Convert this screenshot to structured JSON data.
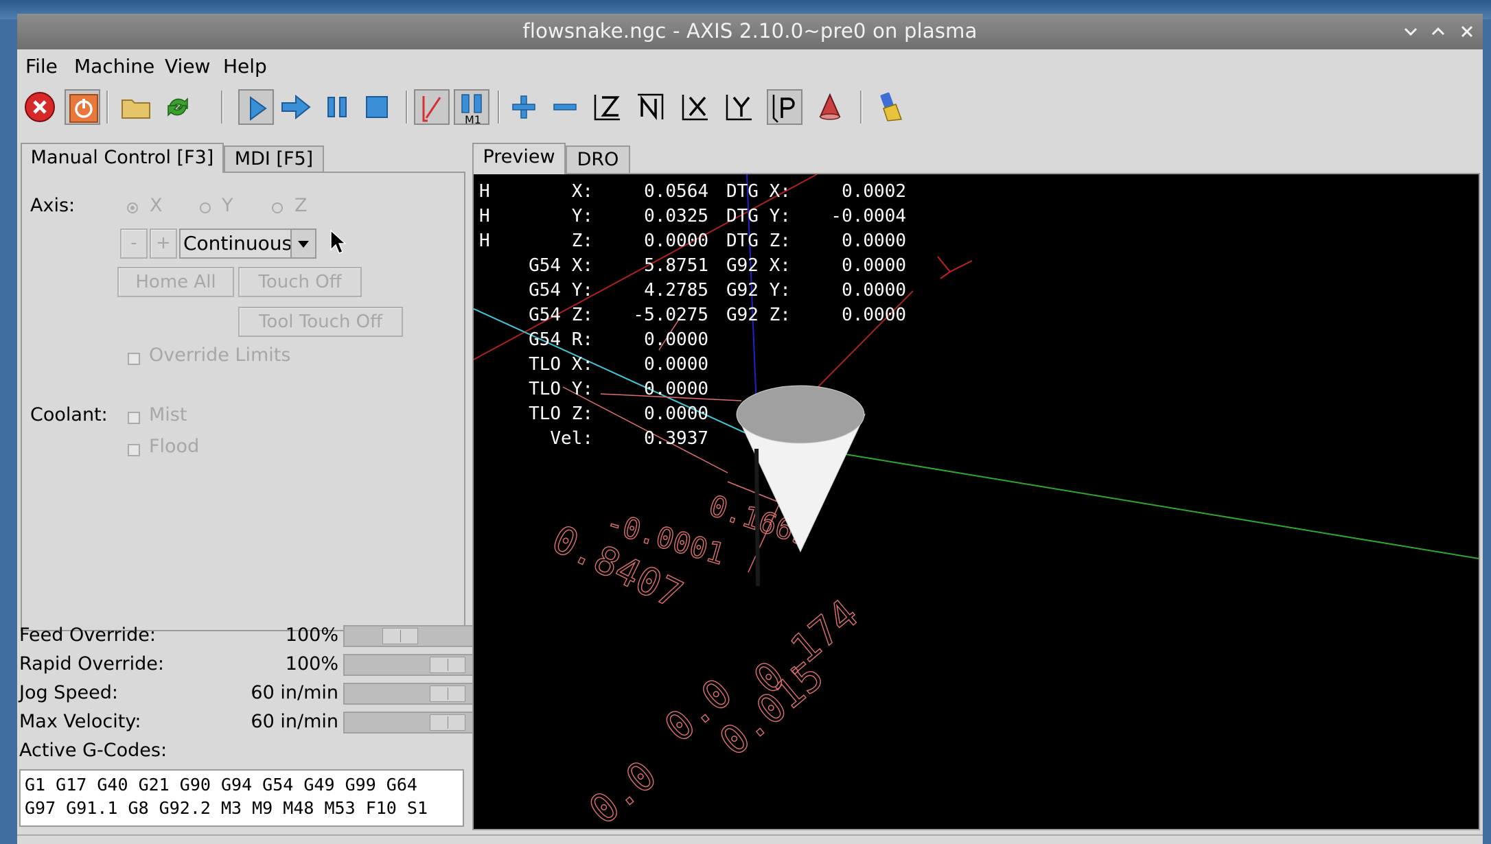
{
  "window": {
    "title": "flowsnake.ngc - AXIS 2.10.0~pre0 on plasma"
  },
  "menu": {
    "file": "File",
    "machine": "Machine",
    "view": "View",
    "help": "Help"
  },
  "toolbar_icons": [
    "estop-icon",
    "power-icon",
    "open-file-icon",
    "reload-icon",
    "run-icon",
    "step-icon",
    "pause-icon",
    "stop-icon",
    "block-delete-icon",
    "optional-stop-icon",
    "zoom-in-icon",
    "zoom-out-icon",
    "view-z-icon",
    "view-z-rotated-icon",
    "view-x-icon",
    "view-y-icon",
    "view-perspective-icon",
    "toggle-tool-icon",
    "clear-plot-icon"
  ],
  "optional_stop_label": "M1",
  "tabs": {
    "manual": "Manual Control [F3]",
    "mdi": "MDI [F5]",
    "preview": "Preview",
    "dro": "DRO"
  },
  "manual": {
    "axis_label": "Axis:",
    "axes": [
      "X",
      "Y",
      "Z"
    ],
    "selected_axis": "X",
    "jog_minus": "-",
    "jog_plus": "+",
    "jog_mode": "Continuous",
    "home_all": "Home All",
    "touch_off": "Touch Off",
    "tool_touch_off": "Tool Touch Off",
    "override_limits": "Override Limits",
    "coolant_label": "Coolant:",
    "mist": "Mist",
    "flood": "Flood"
  },
  "overrides": [
    {
      "label": "Feed Override:",
      "value": "100%",
      "position": 0.38
    },
    {
      "label": "Rapid Override:",
      "value": "100%",
      "position": 0.86
    },
    {
      "label": "Jog Speed:",
      "value": "60 in/min",
      "position": 0.86
    },
    {
      "label": "Max Velocity:",
      "value": "60 in/min",
      "position": 0.86
    }
  ],
  "active_gcodes_label": "Active G-Codes:",
  "active_gcodes": [
    "G1 G17 G40 G21 G90 G94 G54 G49 G99 G64",
    "G97 G91.1 G8 G92.2 M3 M9 M48 M53 F10 S1"
  ],
  "dro": {
    "left": [
      {
        "flag": "H",
        "label": "X:",
        "value": "0.0564"
      },
      {
        "flag": "H",
        "label": "Y:",
        "value": "0.0325"
      },
      {
        "flag": "H",
        "label": "Z:",
        "value": "0.0000"
      },
      {
        "flag": "",
        "label": "G54 X:",
        "value": "5.8751"
      },
      {
        "flag": "",
        "label": "G54 Y:",
        "value": "4.2785"
      },
      {
        "flag": "",
        "label": "G54 Z:",
        "value": "-5.0275"
      },
      {
        "flag": "",
        "label": "G54 R:",
        "value": "0.0000"
      },
      {
        "flag": "",
        "label": "TLO X:",
        "value": "0.0000"
      },
      {
        "flag": "",
        "label": "TLO Y:",
        "value": "0.0000"
      },
      {
        "flag": "",
        "label": "TLO Z:",
        "value": "0.0000"
      },
      {
        "flag": "",
        "label": "Vel:",
        "value": "0.3937"
      }
    ],
    "right": [
      {
        "label": "DTG X:",
        "value": "0.0002"
      },
      {
        "label": "DTG Y:",
        "value": "-0.0004"
      },
      {
        "label": "DTG Z:",
        "value": "0.0000"
      },
      {
        "label": "G92 X:",
        "value": "0.0000"
      },
      {
        "label": "G92 Y:",
        "value": "0.0000"
      },
      {
        "label": "G92 Z:",
        "value": "0.0000"
      }
    ]
  },
  "preview_dimensions": [
    "0.1669",
    "-0.0001",
    "0.8407",
    "0.174",
    "0.015",
    "0.0",
    "0.0"
  ],
  "colors": {
    "x_axis": "#b02020",
    "y_axis": "#2ea82e",
    "z_axis": "#2020c8",
    "feed_path": "#ffffff",
    "dimension": "#e07070",
    "rapid": "#40c8d8"
  }
}
